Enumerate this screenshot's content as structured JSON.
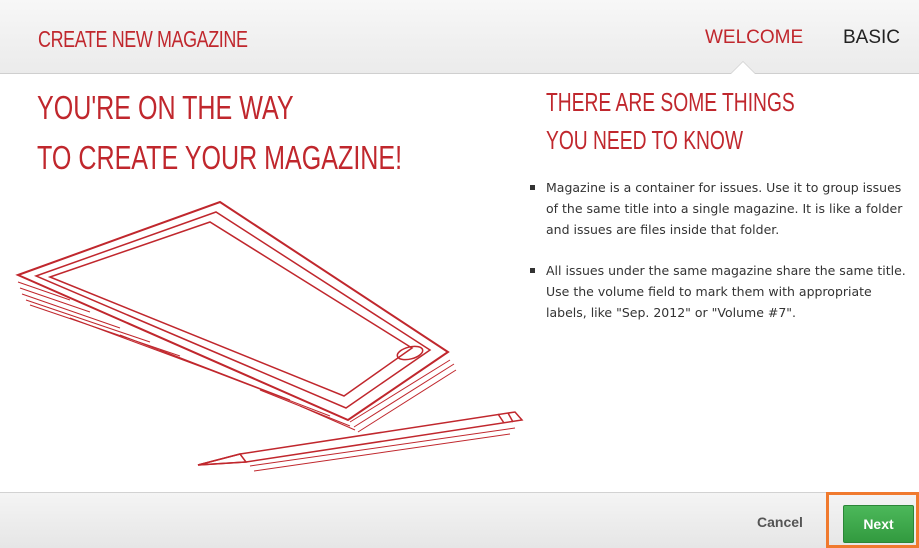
{
  "header": {
    "title": "CREATE NEW MAGAZINE",
    "tabs": [
      {
        "label": "WELCOME",
        "active": true
      },
      {
        "label": "BASIC",
        "active": false
      }
    ]
  },
  "main": {
    "headline_lines": [
      "YOU'RE ON THE WAY",
      "TO CREATE YOUR MAGAZINE!"
    ],
    "subhead_lines": [
      "THERE ARE SOME THINGS",
      "YOU NEED TO KNOW"
    ],
    "bullets": [
      "Magazine is a container for issues. Use it to group issues of the same title into a single magazine. It is like a folder and issues are files inside that folder.",
      "All issues under the same magazine share the same title. Use the volume field to mark them with appropriate labels, like \"Sep. 2012\" or \"Volume #7\"."
    ],
    "illustration_icon": "tablet-and-pencil-illustration"
  },
  "footer": {
    "cancel_label": "Cancel",
    "next_label": "Next"
  },
  "colors": {
    "accent_red": "#c0272d",
    "next_green": "#3aa64a",
    "highlight_orange": "#f07a2e"
  }
}
